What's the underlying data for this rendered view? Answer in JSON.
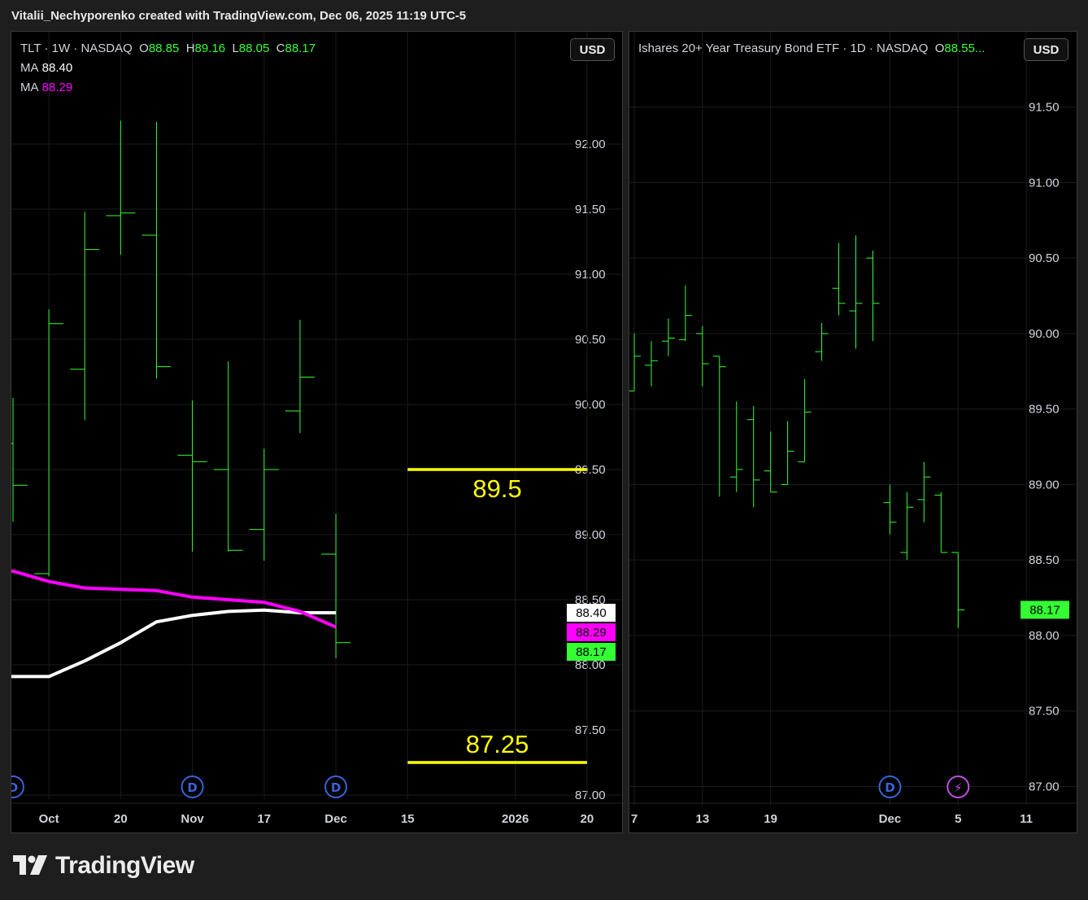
{
  "header": {
    "text": "Vitalii_Nechyporenko created with TradingView.com, Dec 06, 2025 11:19 UTC-5"
  },
  "footer": {
    "brand": "TradingView",
    "logo_icon": "tradingview-logo-icon"
  },
  "colors": {
    "up": "#33ff33",
    "ma_white": "#ffffff",
    "ma_magenta": "#ff00ff",
    "level_line": "#ffff00",
    "background": "#000000",
    "grid": "#1c1c1c",
    "axis_text": "#d1d4dc"
  },
  "left": {
    "legend": {
      "symbol": "TLT · 1W · NASDAQ",
      "o_label": "O",
      "o": "88.85",
      "h_label": "H",
      "h": "89.16",
      "l_label": "L",
      "l": "88.05",
      "c_label": "C",
      "c": "88.17",
      "ma1_label": "MA",
      "ma1": "88.40",
      "ma2_label": "MA",
      "ma2": "88.29"
    },
    "currency_button": "USD",
    "price_tags": [
      {
        "text": "88.40",
        "bg": "#ffffff",
        "fg": "#000000",
        "value": 88.4
      },
      {
        "text": "88.29",
        "bg": "#ff00ff",
        "fg": "#000000",
        "value": 88.29
      },
      {
        "text": "88.17",
        "bg": "#33ff33",
        "fg": "#000000",
        "value": 88.17
      }
    ],
    "event_markers": [
      {
        "label": "D",
        "x_index": 0
      },
      {
        "label": "D",
        "x_index": 5
      },
      {
        "label": "D",
        "x_index": 9
      }
    ]
  },
  "right": {
    "legend": {
      "symbol": "Ishares 20+ Year Treasury Bond ETF · 1D · NASDAQ",
      "o_label": "O",
      "o": "88.55..."
    },
    "currency_button": "USD",
    "price_tags": [
      {
        "text": "88.17",
        "bg": "#33ff33",
        "fg": "#000000",
        "value": 88.17
      }
    ],
    "event_markers": [
      {
        "label": "D",
        "kind": "dividend",
        "x_index": 15
      },
      {
        "label": "⚡",
        "kind": "split",
        "x_index": 19
      }
    ]
  },
  "chart_data": [
    {
      "type": "ohlc",
      "title": "TLT · 1W · NASDAQ",
      "ylim": [
        87.0,
        92.2
      ],
      "y_ticks": [
        "92.00",
        "91.50",
        "91.00",
        "90.50",
        "90.00",
        "89.50",
        "89.00",
        "88.50",
        "88.00",
        "87.50",
        "87.00"
      ],
      "y_tick_values": [
        92.0,
        91.5,
        91.0,
        90.5,
        90.0,
        89.5,
        89.0,
        88.5,
        88.0,
        87.5,
        87.0
      ],
      "x_ticks": [
        {
          "label": "Oct",
          "x_index": 1
        },
        {
          "label": "20",
          "x_index": 3
        },
        {
          "label": "Nov",
          "x_index": 5
        },
        {
          "label": "17",
          "x_index": 7
        },
        {
          "label": "Dec",
          "x_index": 9
        },
        {
          "label": "15",
          "x_index": 11
        },
        {
          "label": "2026",
          "x_index": 14
        },
        {
          "label": "20",
          "x_index": 16
        }
      ],
      "x_range": [
        0,
        17
      ],
      "bars": [
        {
          "x_index": 0,
          "o": 89.7,
          "h": 90.05,
          "l": 89.1,
          "c": 89.38
        },
        {
          "x_index": 1,
          "o": 88.7,
          "h": 90.73,
          "l": 88.68,
          "c": 90.62
        },
        {
          "x_index": 2,
          "o": 90.27,
          "h": 91.48,
          "l": 89.88,
          "c": 91.19
        },
        {
          "x_index": 3,
          "o": 91.45,
          "h": 92.18,
          "l": 91.15,
          "c": 91.47
        },
        {
          "x_index": 4,
          "o": 91.3,
          "h": 92.17,
          "l": 90.2,
          "c": 90.29
        },
        {
          "x_index": 5,
          "o": 89.61,
          "h": 90.03,
          "l": 88.87,
          "c": 89.56
        },
        {
          "x_index": 6,
          "o": 89.5,
          "h": 90.33,
          "l": 88.87,
          "c": 88.88
        },
        {
          "x_index": 7,
          "o": 89.04,
          "h": 89.66,
          "l": 88.8,
          "c": 89.5
        },
        {
          "x_index": 8,
          "o": 89.95,
          "h": 90.65,
          "l": 89.78,
          "c": 90.21
        },
        {
          "x_index": 9,
          "o": 88.85,
          "h": 89.16,
          "l": 88.05,
          "c": 88.17
        }
      ],
      "series": [
        {
          "name": "MA",
          "value_label": "88.40",
          "color": "#ffffff",
          "x_index": [
            0,
            1,
            2,
            3,
            4,
            5,
            6,
            7,
            8,
            9
          ],
          "values": [
            87.91,
            87.91,
            88.03,
            88.17,
            88.33,
            88.38,
            88.41,
            88.42,
            88.4,
            88.4
          ]
        },
        {
          "name": "MA",
          "value_label": "88.29",
          "color": "#ff00ff",
          "x_index": [
            0,
            1,
            2,
            3,
            4,
            5,
            6,
            7,
            8,
            9
          ],
          "values": [
            88.72,
            88.64,
            88.59,
            88.58,
            88.57,
            88.52,
            88.5,
            88.48,
            88.41,
            88.29
          ]
        }
      ],
      "annotations": [
        {
          "text": "89.5",
          "value": 89.5,
          "x_from": 11,
          "x_to": 16,
          "color": "#ffff00",
          "label_position": "below"
        },
        {
          "text": "87.25",
          "value": 87.25,
          "x_from": 11,
          "x_to": 16,
          "color": "#ffff00",
          "label_position": "above"
        }
      ]
    },
    {
      "type": "ohlc",
      "title": "Ishares 20+ Year Treasury Bond ETF · 1D · NASDAQ",
      "ylim": [
        86.9,
        91.8
      ],
      "y_ticks": [
        "91.50",
        "91.00",
        "90.50",
        "90.00",
        "89.50",
        "89.00",
        "88.50",
        "88.00",
        "87.50",
        "87.00"
      ],
      "y_tick_values": [
        91.5,
        91.0,
        90.5,
        90.0,
        89.5,
        89.0,
        88.5,
        88.0,
        87.5,
        87.0
      ],
      "x_ticks": [
        {
          "label": "7",
          "x_index": 0
        },
        {
          "label": "13",
          "x_index": 4
        },
        {
          "label": "19",
          "x_index": 8
        },
        {
          "label": "Dec",
          "x_index": 15
        },
        {
          "label": "5",
          "x_index": 19
        },
        {
          "label": "11",
          "x_index": 23
        }
      ],
      "x_range": [
        0,
        26
      ],
      "bars": [
        {
          "x_index": 0,
          "o": 89.62,
          "h": 90.0,
          "l": 89.62,
          "c": 89.85
        },
        {
          "x_index": 1,
          "o": 89.79,
          "h": 89.95,
          "l": 89.65,
          "c": 89.82
        },
        {
          "x_index": 2,
          "o": 89.95,
          "h": 90.1,
          "l": 89.85,
          "c": 89.97
        },
        {
          "x_index": 3,
          "o": 89.96,
          "h": 90.32,
          "l": 89.95,
          "c": 90.12
        },
        {
          "x_index": 4,
          "o": 90.0,
          "h": 90.05,
          "l": 89.65,
          "c": 89.8
        },
        {
          "x_index": 5,
          "o": 89.85,
          "h": 89.85,
          "l": 88.92,
          "c": 89.78
        },
        {
          "x_index": 6,
          "o": 89.05,
          "h": 89.55,
          "l": 88.95,
          "c": 89.1
        },
        {
          "x_index": 7,
          "o": 89.43,
          "h": 89.52,
          "l": 88.85,
          "c": 89.03
        },
        {
          "x_index": 8,
          "o": 89.09,
          "h": 89.35,
          "l": 88.95,
          "c": 88.95
        },
        {
          "x_index": 9,
          "o": 89.0,
          "h": 89.42,
          "l": 89.0,
          "c": 89.22
        },
        {
          "x_index": 10,
          "o": 89.15,
          "h": 89.7,
          "l": 89.15,
          "c": 89.48
        },
        {
          "x_index": 11,
          "o": 89.88,
          "h": 90.07,
          "l": 89.82,
          "c": 90.0
        },
        {
          "x_index": 12,
          "o": 90.3,
          "h": 90.6,
          "l": 90.12,
          "c": 90.2
        },
        {
          "x_index": 13,
          "o": 90.15,
          "h": 90.65,
          "l": 89.9,
          "c": 90.2
        },
        {
          "x_index": 14,
          "o": 90.5,
          "h": 90.55,
          "l": 89.95,
          "c": 90.2
        },
        {
          "x_index": 15,
          "o": 88.88,
          "h": 89.0,
          "l": 88.67,
          "c": 88.75
        },
        {
          "x_index": 16,
          "o": 88.55,
          "h": 88.95,
          "l": 88.5,
          "c": 88.85
        },
        {
          "x_index": 17,
          "o": 88.9,
          "h": 89.15,
          "l": 88.75,
          "c": 89.05
        },
        {
          "x_index": 18,
          "o": 88.93,
          "h": 88.95,
          "l": 88.55,
          "c": 88.55
        },
        {
          "x_index": 19,
          "o": 88.55,
          "h": 88.55,
          "l": 88.05,
          "c": 88.17
        }
      ]
    }
  ]
}
